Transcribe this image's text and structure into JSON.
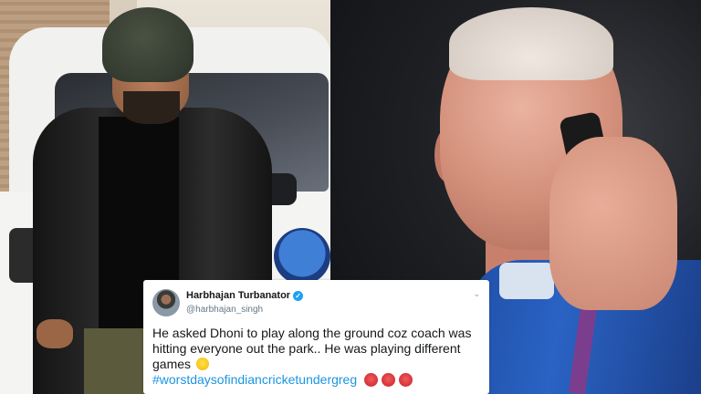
{
  "tweet": {
    "display_name": "Harbhajan Turbanator",
    "handle": "@harbhajan_singh",
    "verified": true,
    "text": "He asked Dhoni to play along the ground coz coach was hitting everyone out the park.. He was playing different games",
    "hashtag": "#worstdaysofindiancricketundergreg",
    "icons": {
      "verified": "verified-badge-icon",
      "menu": "chevron-down-icon",
      "emoji_after_text": "winking-face-with-tongue-emoji",
      "emoji_after_hashtag": [
        "angry-face-emoji",
        "angry-face-emoji",
        "angry-face-emoji"
      ]
    },
    "colors": {
      "hashtag": "#1b95e0",
      "verified": "#1da1f2",
      "name": "#14171a",
      "handle": "#657786"
    }
  },
  "photos": {
    "left": "man-in-beanie-and-leather-jacket-photo",
    "right": "man-on-phone-in-blue-shirt-photo"
  }
}
